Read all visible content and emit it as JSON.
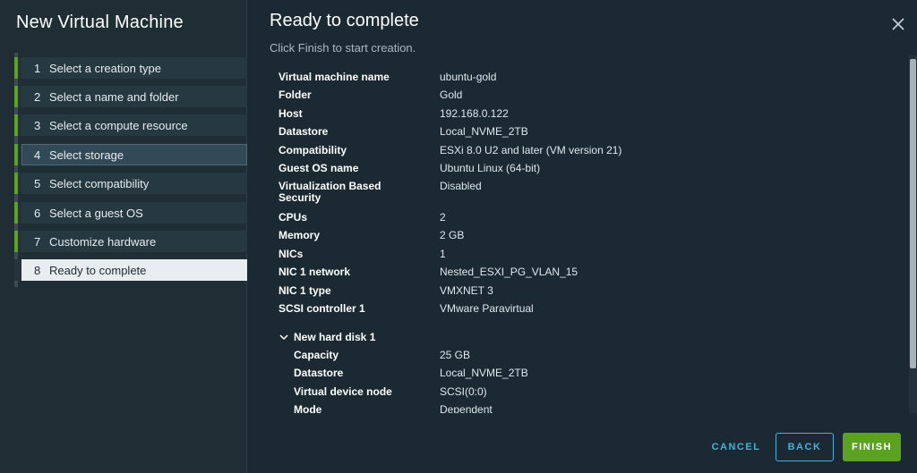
{
  "sidebar": {
    "title": "New Virtual Machine",
    "steps": [
      {
        "num": "1",
        "label": "Select a creation type"
      },
      {
        "num": "2",
        "label": "Select a name and folder"
      },
      {
        "num": "3",
        "label": "Select a compute resource"
      },
      {
        "num": "4",
        "label": "Select storage"
      },
      {
        "num": "5",
        "label": "Select compatibility"
      },
      {
        "num": "6",
        "label": "Select a guest OS"
      },
      {
        "num": "7",
        "label": "Customize hardware"
      },
      {
        "num": "8",
        "label": "Ready to complete"
      }
    ]
  },
  "main": {
    "title": "Ready to complete",
    "subtitle": "Click Finish to start creation.",
    "summary": [
      {
        "key": "Virtual machine name",
        "value": "ubuntu-gold"
      },
      {
        "key": "Folder",
        "value": "Gold"
      },
      {
        "key": "Host",
        "value": "192.168.0.122"
      },
      {
        "key": "Datastore",
        "value": "Local_NVME_2TB"
      },
      {
        "key": "Compatibility",
        "value": "ESXi 8.0 U2 and later (VM version 21)"
      },
      {
        "key": "Guest OS name",
        "value": "Ubuntu Linux (64-bit)"
      },
      {
        "key": "Virtualization Based Security",
        "value": "Disabled"
      },
      {
        "key": "CPUs",
        "value": "2"
      },
      {
        "key": "Memory",
        "value": "2 GB"
      },
      {
        "key": "NICs",
        "value": "1"
      },
      {
        "key": "NIC 1 network",
        "value": "Nested_ESXI_PG_VLAN_15"
      },
      {
        "key": "NIC 1 type",
        "value": "VMXNET 3"
      },
      {
        "key": "SCSI controller 1",
        "value": "VMware Paravirtual"
      }
    ],
    "disk": {
      "title": "New hard disk 1",
      "rows": [
        {
          "key": "Capacity",
          "value": "25 GB"
        },
        {
          "key": "Datastore",
          "value": "Local_NVME_2TB"
        },
        {
          "key": "Virtual device node",
          "value": "SCSI(0:0)"
        },
        {
          "key": "Mode",
          "value": "Dependent"
        }
      ]
    }
  },
  "footer": {
    "cancel": "CANCEL",
    "back": "BACK",
    "finish": "FINISH"
  },
  "colors": {
    "accent": "#5aa220",
    "link": "#49afd9",
    "background": "#1b2a32"
  }
}
